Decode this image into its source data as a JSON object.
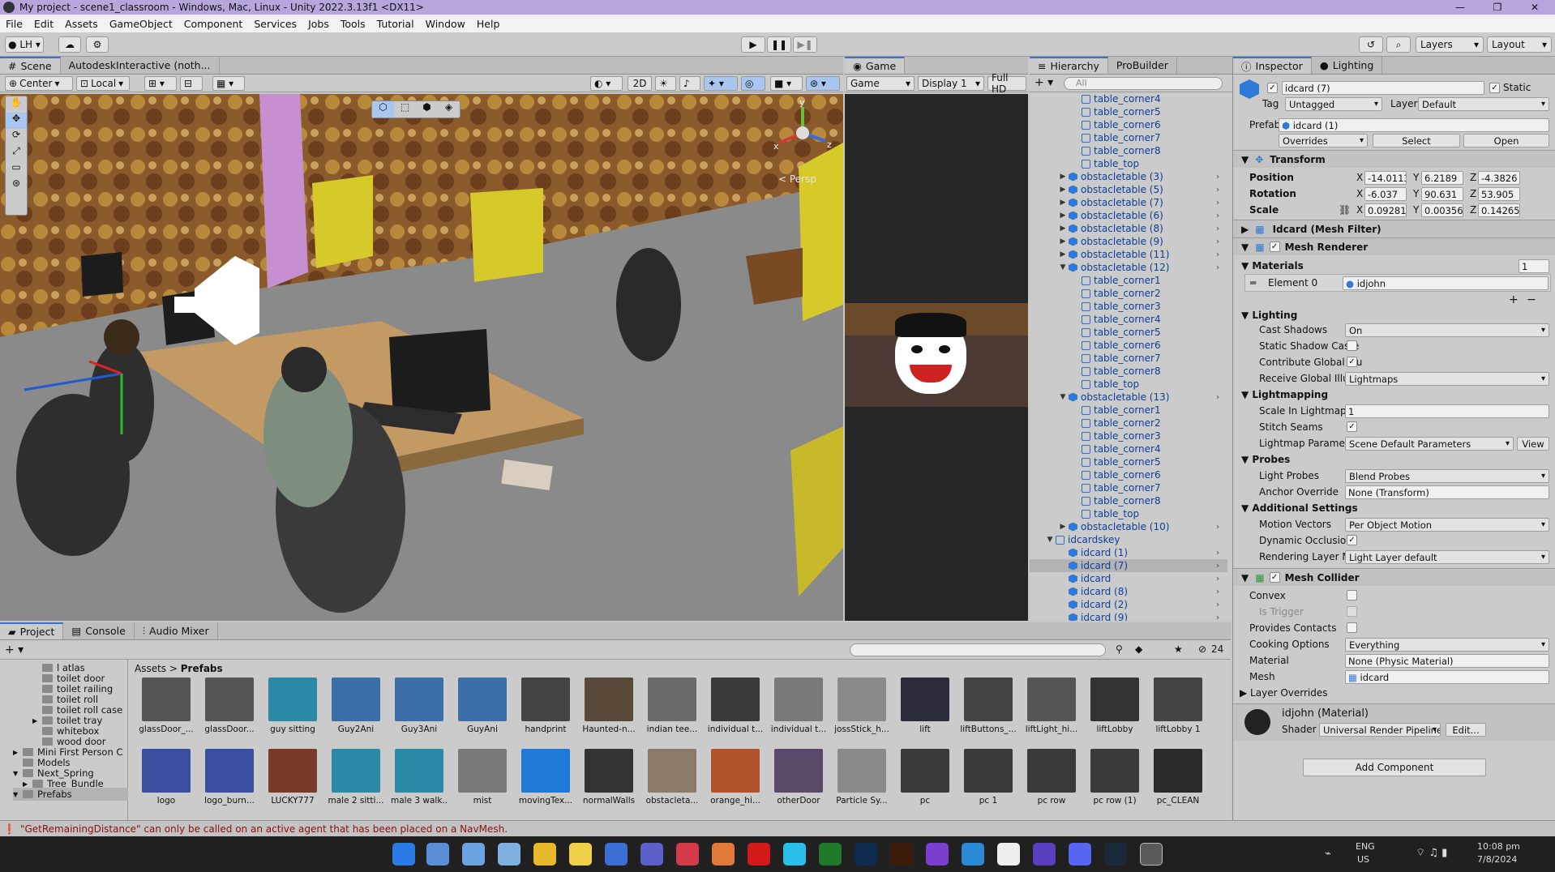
{
  "window": {
    "title": "My project - scene1_classroom - Windows, Mac, Linux - Unity 2022.3.13f1 <DX11>",
    "min": "—",
    "max": "❐",
    "close": "✕"
  },
  "menu": [
    "File",
    "Edit",
    "Assets",
    "GameObject",
    "Component",
    "Services",
    "Jobs",
    "Tools",
    "Tutorial",
    "Window",
    "Help"
  ],
  "toolbar": {
    "account": "LH",
    "layers": "Layers",
    "layout": "Layout"
  },
  "scene_tabs": {
    "scene": "Scene",
    "autodesk": "AutodeskInteractive (noth..."
  },
  "scene_bar": {
    "pivot": "Center",
    "space": "Local",
    "mode2d": "2D"
  },
  "scene": {
    "persp": "< Persp",
    "axis_y": "y",
    "axis_z": "z",
    "axis_x": "x"
  },
  "game_tabs": {
    "game": "Game",
    "mode": "Game",
    "display": "Display 1",
    "res": "Full HD"
  },
  "hierarchy": {
    "tab": "Hierarchy",
    "tab2": "ProBuilder",
    "search": "All",
    "rows": [
      {
        "label": "table_corner4",
        "indent": 3,
        "icon": "outline"
      },
      {
        "label": "table_corner5",
        "indent": 3,
        "icon": "outline"
      },
      {
        "label": "table_corner6",
        "indent": 3,
        "icon": "outline"
      },
      {
        "label": "table_corner7",
        "indent": 3,
        "icon": "outline"
      },
      {
        "label": "table_corner8",
        "indent": 3,
        "icon": "outline"
      },
      {
        "label": "table_top",
        "indent": 3,
        "icon": "outline"
      },
      {
        "label": "obstacletable (3)",
        "indent": 2,
        "icon": "cube",
        "arrow": "▶",
        "chev": true
      },
      {
        "label": "obstacletable (5)",
        "indent": 2,
        "icon": "cube",
        "arrow": "▶",
        "chev": true
      },
      {
        "label": "obstacletable (7)",
        "indent": 2,
        "icon": "cube",
        "arrow": "▶",
        "chev": true
      },
      {
        "label": "obstacletable (6)",
        "indent": 2,
        "icon": "cube",
        "arrow": "▶",
        "chev": true
      },
      {
        "label": "obstacletable (8)",
        "indent": 2,
        "icon": "cube",
        "arrow": "▶",
        "chev": true
      },
      {
        "label": "obstacletable (9)",
        "indent": 2,
        "icon": "cube",
        "arrow": "▶",
        "chev": true
      },
      {
        "label": "obstacletable (11)",
        "indent": 2,
        "icon": "cube",
        "arrow": "▶",
        "chev": true
      },
      {
        "label": "obstacletable (12)",
        "indent": 2,
        "icon": "cube",
        "arrow": "▼",
        "chev": true
      },
      {
        "label": "table_corner1",
        "indent": 3,
        "icon": "outline"
      },
      {
        "label": "table_corner2",
        "indent": 3,
        "icon": "outline"
      },
      {
        "label": "table_corner3",
        "indent": 3,
        "icon": "outline"
      },
      {
        "label": "table_corner4",
        "indent": 3,
        "icon": "outline"
      },
      {
        "label": "table_corner5",
        "indent": 3,
        "icon": "outline"
      },
      {
        "label": "table_corner6",
        "indent": 3,
        "icon": "outline"
      },
      {
        "label": "table_corner7",
        "indent": 3,
        "icon": "outline"
      },
      {
        "label": "table_corner8",
        "indent": 3,
        "icon": "outline"
      },
      {
        "label": "table_top",
        "indent": 3,
        "icon": "outline"
      },
      {
        "label": "obstacletable (13)",
        "indent": 2,
        "icon": "cube",
        "arrow": "▼",
        "chev": true
      },
      {
        "label": "table_corner1",
        "indent": 3,
        "icon": "outline"
      },
      {
        "label": "table_corner2",
        "indent": 3,
        "icon": "outline"
      },
      {
        "label": "table_corner3",
        "indent": 3,
        "icon": "outline"
      },
      {
        "label": "table_corner4",
        "indent": 3,
        "icon": "outline"
      },
      {
        "label": "table_corner5",
        "indent": 3,
        "icon": "outline"
      },
      {
        "label": "table_corner6",
        "indent": 3,
        "icon": "outline"
      },
      {
        "label": "table_corner7",
        "indent": 3,
        "icon": "outline"
      },
      {
        "label": "table_corner8",
        "indent": 3,
        "icon": "outline"
      },
      {
        "label": "table_top",
        "indent": 3,
        "icon": "outline"
      },
      {
        "label": "obstacletable (10)",
        "indent": 2,
        "icon": "cube",
        "arrow": "▶",
        "chev": true
      },
      {
        "label": "idcardskey",
        "indent": 1,
        "icon": "outline",
        "arrow": "▼"
      },
      {
        "label": "idcard (1)",
        "indent": 2,
        "icon": "cube",
        "chev": true
      },
      {
        "label": "idcard (7)",
        "indent": 2,
        "icon": "cube",
        "chev": true,
        "selected": true
      },
      {
        "label": "idcard",
        "indent": 2,
        "icon": "cube",
        "chev": true
      },
      {
        "label": "idcard (8)",
        "indent": 2,
        "icon": "cube",
        "chev": true
      },
      {
        "label": "idcard (2)",
        "indent": 2,
        "icon": "cube",
        "chev": true
      },
      {
        "label": "idcard (9)",
        "indent": 2,
        "icon": "cube",
        "chev": true
      }
    ]
  },
  "inspector": {
    "tab": "Inspector",
    "tab2": "Lighting",
    "object_name": "idcard (7)",
    "static": "Static",
    "tag_label": "Tag",
    "tag": "Untagged",
    "layer_label": "Layer",
    "layer": "Default",
    "prefab_label": "Prefab",
    "prefab": "idcard (1)",
    "overrides": "Overrides",
    "select": "Select",
    "open": "Open",
    "transform": {
      "title": "Transform",
      "position": {
        "label": "Position",
        "x": "-14.0113",
        "y": "6.2189",
        "z": "-4.3826"
      },
      "rotation": {
        "label": "Rotation",
        "x": "-6.037",
        "y": "90.631",
        "z": "53.905"
      },
      "scale": {
        "label": "Scale",
        "x": "0.092813",
        "y": "0.003563",
        "z": "0.142655"
      }
    },
    "mesh_filter": "Idcard (Mesh Filter)",
    "mesh_renderer": "Mesh Renderer",
    "materials": {
      "label": "Materials",
      "count": "1",
      "element": "Element 0",
      "value": "idjohn"
    },
    "lighting": {
      "title": "Lighting",
      "cast_shadows": {
        "label": "Cast Shadows",
        "value": "On"
      },
      "static_shadow": "Static Shadow Caste",
      "contribute": "Contribute Global Illu",
      "receive": {
        "label": "Receive Global Illumi",
        "value": "Lightmaps"
      }
    },
    "lightmapping": {
      "title": "Lightmapping",
      "scale": {
        "label": "Scale In Lightmap",
        "value": "1"
      },
      "stitch": "Stitch Seams",
      "params": {
        "label": "Lightmap Parameters",
        "value": "Scene Default Parameters",
        "view": "View"
      }
    },
    "probes": {
      "title": "Probes",
      "light": {
        "label": "Light Probes",
        "value": "Blend Probes"
      },
      "anchor": {
        "label": "Anchor Override",
        "value": "None (Transform)"
      }
    },
    "additional": {
      "title": "Additional Settings",
      "motion": {
        "label": "Motion Vectors",
        "value": "Per Object Motion"
      },
      "dynamic": "Dynamic Occlusion",
      "rendering": {
        "label": "Rendering Layer Mas",
        "value": "Light Layer default"
      }
    },
    "mesh_collider": {
      "title": "Mesh Collider",
      "convex": "Convex",
      "trigger": "Is Trigger",
      "contacts": "Provides Contacts",
      "cooking": {
        "label": "Cooking Options",
        "value": "Everything"
      },
      "material": {
        "label": "Material",
        "value": "None (Physic Material)"
      },
      "mesh": {
        "label": "Mesh",
        "value": "idcard"
      },
      "layer_overrides": "Layer Overrides"
    },
    "material_asset": {
      "name": "idjohn (Material)",
      "shader_label": "Shader",
      "shader": "Universal Render Pipeline/Lit",
      "edit": "Edit..."
    },
    "add_component": "Add Component"
  },
  "project": {
    "tabs": [
      "Project",
      "Console",
      "Audio Mixer"
    ],
    "breadcrumb": {
      "root": "Assets",
      "current": "Prefabs"
    },
    "hidden_count": "24",
    "tree": [
      {
        "label": "l atlas",
        "indent": 3
      },
      {
        "label": "toilet door",
        "indent": 3
      },
      {
        "label": "toilet railing",
        "indent": 3
      },
      {
        "label": "toilet roll",
        "indent": 3
      },
      {
        "label": "toilet roll case",
        "indent": 3
      },
      {
        "label": "toilet tray",
        "indent": 3,
        "arrow": "▶"
      },
      {
        "label": "whitebox",
        "indent": 3
      },
      {
        "label": "wood door",
        "indent": 3
      },
      {
        "label": "Mini First Person C",
        "indent": 1,
        "arrow": "▶"
      },
      {
        "label": "Models",
        "indent": 1
      },
      {
        "label": "Next_Spring",
        "indent": 1,
        "arrow": "▼"
      },
      {
        "label": "Tree_Bundle",
        "indent": 2,
        "arrow": "▶"
      },
      {
        "label": "Prefabs",
        "indent": 1,
        "arrow": "▼",
        "selected": true
      }
    ],
    "assets_row1": [
      "glassDoor_...",
      "glassDoor...",
      "guy sitting",
      "Guy2Ani",
      "Guy3Ani",
      "GuyAni",
      "handprint",
      "Haunted-n...",
      "indian tee...",
      "individual t...",
      "individual t...",
      "jossStick_h...",
      "lift",
      "liftButtons_...",
      "liftLight_hi...",
      "liftLobby",
      "liftLobby 1"
    ],
    "assets_row2": [
      "logo",
      "logo_burn...",
      "LUCKY777",
      "male 2 sitti...",
      "male 3 walk...",
      "mist",
      "movingTex...",
      "normalWalls",
      "obstacleta...",
      "orange_hi...",
      "otherDoor",
      "Particle Sy...",
      "pc",
      "pc 1",
      "pc row",
      "pc row (1)",
      "pc_CLEAN"
    ]
  },
  "status": {
    "message": "\"GetRemainingDistance\" can only be called on an active agent that has been placed on a NavMesh."
  },
  "taskbar": {
    "lang": "ENG",
    "region": "US",
    "time": "10:08 pm",
    "date": "7/8/2024"
  }
}
